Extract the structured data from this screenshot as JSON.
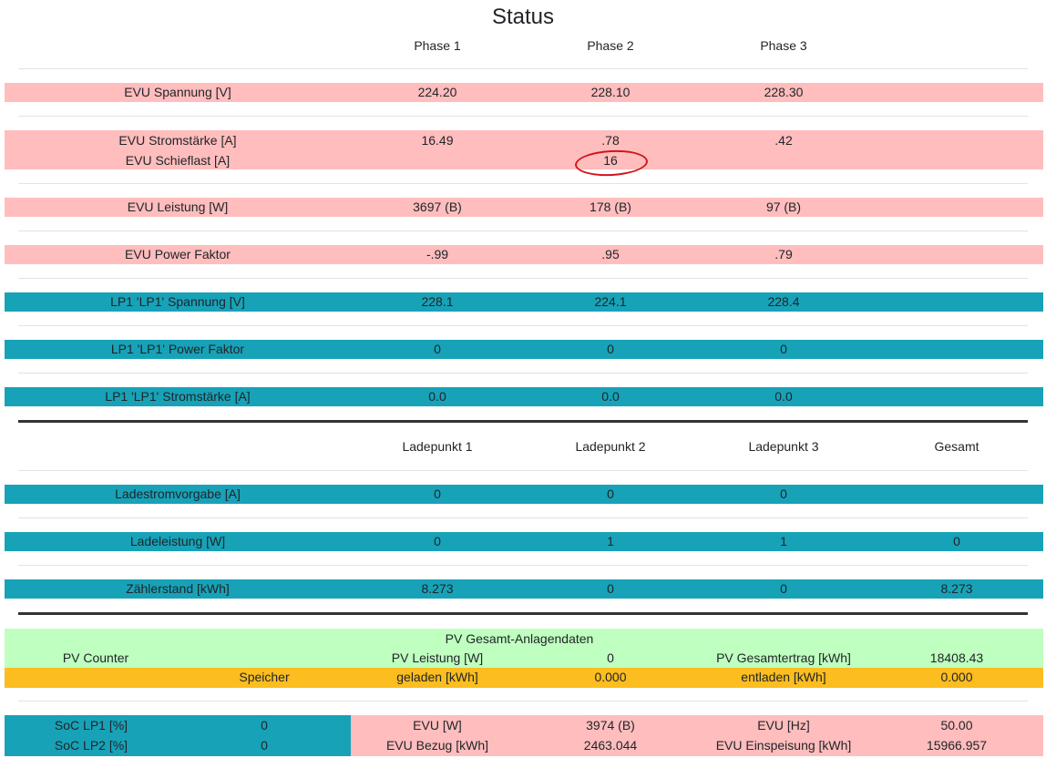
{
  "title": "Status",
  "phase_headers": [
    "Phase 1",
    "Phase 2",
    "Phase 3"
  ],
  "evu": {
    "spannung": {
      "label": "EVU Spannung [V]",
      "values": [
        "224.20",
        "228.10",
        "228.30"
      ]
    },
    "strom": {
      "label": "EVU Stromstärke [A]",
      "values": [
        "16.49",
        ".78",
        ".42"
      ]
    },
    "schieflast": {
      "label": "EVU Schieflast [A]",
      "value": "16"
    },
    "leistung": {
      "label": "EVU Leistung [W]",
      "values": [
        "3697 (B)",
        "178 (B)",
        "97 (B)"
      ]
    },
    "pf": {
      "label": "EVU Power Faktor",
      "values": [
        "-.99",
        ".95",
        ".79"
      ]
    }
  },
  "lp1": {
    "spannung": {
      "label": "LP1 'LP1' Spannung [V]",
      "values": [
        "228.1",
        "224.1",
        "228.4"
      ]
    },
    "pf": {
      "label": "LP1 'LP1' Power Faktor",
      "values": [
        "0",
        "0",
        "0"
      ]
    },
    "strom": {
      "label": "LP1 'LP1' Stromstärke [A]",
      "values": [
        "0.0",
        "0.0",
        "0.0"
      ]
    }
  },
  "lp_headers": [
    "Ladepunkt 1",
    "Ladepunkt 2",
    "Ladepunkt 3",
    "Gesamt"
  ],
  "lp": {
    "vorgabe": {
      "label": "Ladestromvorgabe [A]",
      "values": [
        "0",
        "0",
        "0"
      ]
    },
    "leistung": {
      "label": "Ladeleistung [W]",
      "values": [
        "0",
        "1",
        "1",
        "0"
      ]
    },
    "zaehler": {
      "label": "Zählerstand [kWh]",
      "values": [
        "8.273",
        "0",
        "0",
        "8.273"
      ]
    }
  },
  "pv": {
    "title": "PV Gesamt-Anlagendaten",
    "counter": "PV Counter",
    "leistung_label": "PV Leistung [W]",
    "leistung": "0",
    "ertrag_label": "PV Gesamtertrag [kWh]",
    "ertrag": "18408.43"
  },
  "speicher": {
    "label": "Speicher",
    "geladen_label": "geladen [kWh]",
    "geladen": "0.000",
    "entladen_label": "entladen [kWh]",
    "entladen": "0.000"
  },
  "bottom": {
    "soc1_label": "SoC LP1 [%]",
    "soc1": "0",
    "soc2_label": "SoC LP2 [%]",
    "soc2": "0",
    "evu_w_label": "EVU [W]",
    "evu_w": "3974 (B)",
    "evu_hz_label": "EVU [Hz]",
    "evu_hz": "50.00",
    "bezug_label": "EVU Bezug [kWh]",
    "bezug": "2463.044",
    "einsp_label": "EVU Einspeisung [kWh]",
    "einsp": "15966.957"
  }
}
